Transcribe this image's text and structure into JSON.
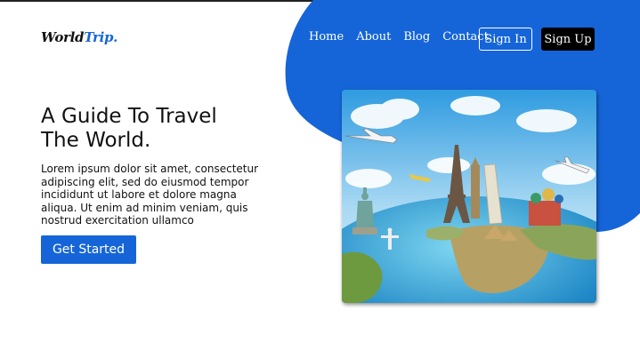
{
  "logo": {
    "part1": "World",
    "part2": "Trip."
  },
  "nav": {
    "items": [
      "Home",
      "About",
      "Blog",
      "Contact"
    ]
  },
  "auth": {
    "sign_in": "Sign In",
    "sign_up": "Sign Up"
  },
  "hero": {
    "title_line1": "A Guide To Travel",
    "title_line2": "The World.",
    "text": "Lorem ipsum dolor sit amet, consectetur adipiscing elit, sed do eiusmod tempor incididunt ut labore et dolore magna aliqua. Ut enim ad minim veniam, quis nostrud exercitation ullamco",
    "cta": "Get Started"
  },
  "colors": {
    "accent": "#1565d8",
    "dark": "#000000"
  },
  "icons": {
    "hero_image": "world-travel-landmarks-globe"
  }
}
